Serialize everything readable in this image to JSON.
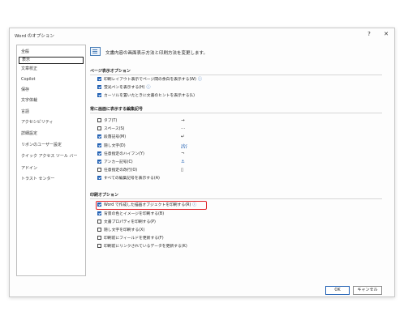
{
  "window": {
    "title": "Word のオプション",
    "help_glyph": "?",
    "close_glyph": "✕"
  },
  "sidebar": {
    "items": [
      {
        "label": "全般"
      },
      {
        "label": "表示",
        "selected": true
      },
      {
        "label": "文章校正"
      },
      {
        "label": "Copilot"
      },
      {
        "label": "保存"
      },
      {
        "label": "文字体裁"
      },
      {
        "label": "言語"
      },
      {
        "label": "アクセシビリティ"
      },
      {
        "label": "詳細設定"
      },
      {
        "label": "リボンのユーザー設定"
      },
      {
        "label": "クイック アクセス ツール バー"
      },
      {
        "label": "アドイン"
      },
      {
        "label": "トラスト センター"
      }
    ]
  },
  "header": {
    "text": "文書内容の画面表示方法と印刷方法を変更します。"
  },
  "page_display": {
    "title": "ページ表示オプション",
    "options": [
      {
        "label": "印刷レイアウト表示でページ間の余白を表示する(W)",
        "checked": true,
        "info": true
      },
      {
        "label": "蛍光ペンを表示する(H)",
        "checked": true,
        "info": true
      },
      {
        "label": "カーソルを置いたときに文書のヒントを表示する(L)",
        "checked": true,
        "info": false
      }
    ]
  },
  "formatting_marks": {
    "title": "常に画面に表示する編集記号",
    "options": [
      {
        "label": "タブ(T)",
        "checked": false,
        "symbol": "→",
        "symbol_blue": false
      },
      {
        "label": "スペース(S)",
        "checked": false,
        "symbol": "···",
        "symbol_blue": false
      },
      {
        "label": "段落記号(M)",
        "checked": true,
        "symbol": "↵",
        "symbol_blue": false
      },
      {
        "label": "隠し文字(D)",
        "checked": true,
        "symbol": "abc",
        "symbol_blue": true
      },
      {
        "label": "任意指定のハイフン(Y)",
        "checked": true,
        "symbol": "¬",
        "symbol_blue": false
      },
      {
        "label": "アンカー記号(C)",
        "checked": true,
        "symbol": "⚓",
        "symbol_blue": true
      },
      {
        "label": "任意指定の改行(O)",
        "checked": false,
        "symbol": "▯",
        "symbol_blue": false
      },
      {
        "label": "すべての編集記号を表示する(A)",
        "checked": true,
        "symbol": "",
        "symbol_blue": false
      }
    ]
  },
  "print": {
    "title": "印刷オプション",
    "options": [
      {
        "label": "Word で作成した描画オブジェクトを印刷する(R)",
        "checked": true,
        "info": true
      },
      {
        "label": "背景の色とイメージを印刷する(B)",
        "checked": true,
        "info": false
      },
      {
        "label": "文書プロパティを印刷する(P)",
        "checked": false,
        "info": false
      },
      {
        "label": "隠し文字を印刷する(X)",
        "checked": false,
        "info": false
      },
      {
        "label": "印刷前にフィールドを更新する(F)",
        "checked": false,
        "info": false
      },
      {
        "label": "印刷前にリンクされているデータを更新する(K)",
        "checked": false,
        "info": false
      }
    ]
  },
  "buttons": {
    "ok": "OK",
    "cancel": "キャンセル"
  },
  "colors": {
    "accent": "#1f5fb3",
    "highlight_border": "#e0242a"
  }
}
